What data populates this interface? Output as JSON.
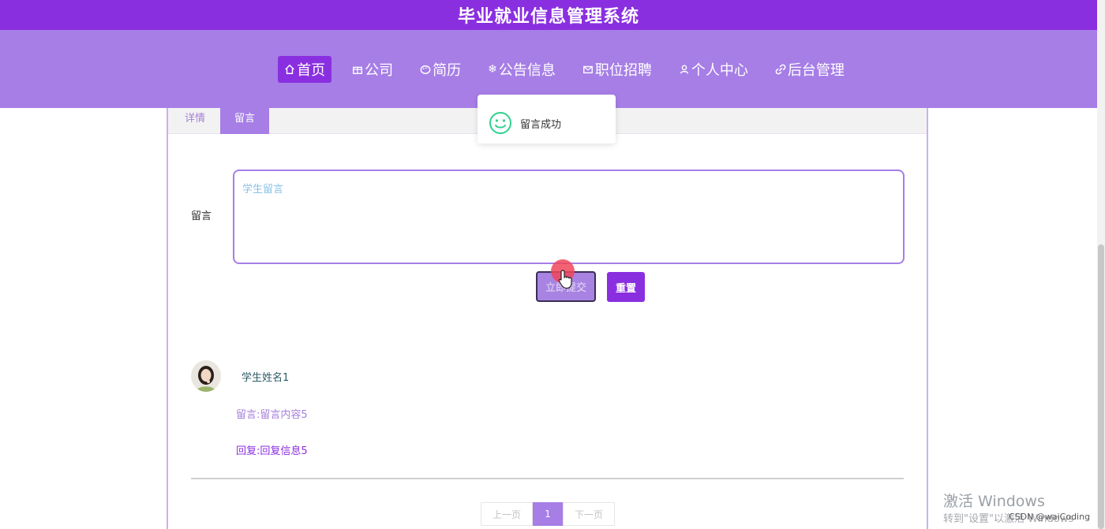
{
  "header": {
    "site_title": "毕业就业信息管理系统"
  },
  "nav": {
    "items": [
      {
        "label": "首页",
        "icon": "home-icon",
        "active": true
      },
      {
        "label": "公司",
        "icon": "gift-icon"
      },
      {
        "label": "简历",
        "icon": "palette-icon"
      },
      {
        "label": "公告信息",
        "icon": "snowflake-icon"
      },
      {
        "label": "职位招聘",
        "icon": "mail-icon"
      },
      {
        "label": "个人中心",
        "icon": "user-icon"
      },
      {
        "label": "后台管理",
        "icon": "link-icon"
      }
    ]
  },
  "tabs": {
    "detail": "详情",
    "message": "留言"
  },
  "form": {
    "label": "留言",
    "placeholder": "学生留言",
    "submit_label": "立即提交",
    "reset_label": "重置"
  },
  "comment": {
    "name": "学生姓名1",
    "text": "留言:留言内容5",
    "reply": "回复:回复信息5"
  },
  "pagination": {
    "prev": "上一页",
    "current": "1",
    "next": "下一页"
  },
  "toast": {
    "message": "留言成功"
  },
  "watermark": {
    "line1": "激活 Windows",
    "line2": "转到\"设置\"以激活 Windows",
    "csdn": "CSDN @waiCoding"
  },
  "colors": {
    "primary": "#8a2fe0",
    "nav_bg": "#a67ee6",
    "toast_icon": "#2fd18f"
  }
}
